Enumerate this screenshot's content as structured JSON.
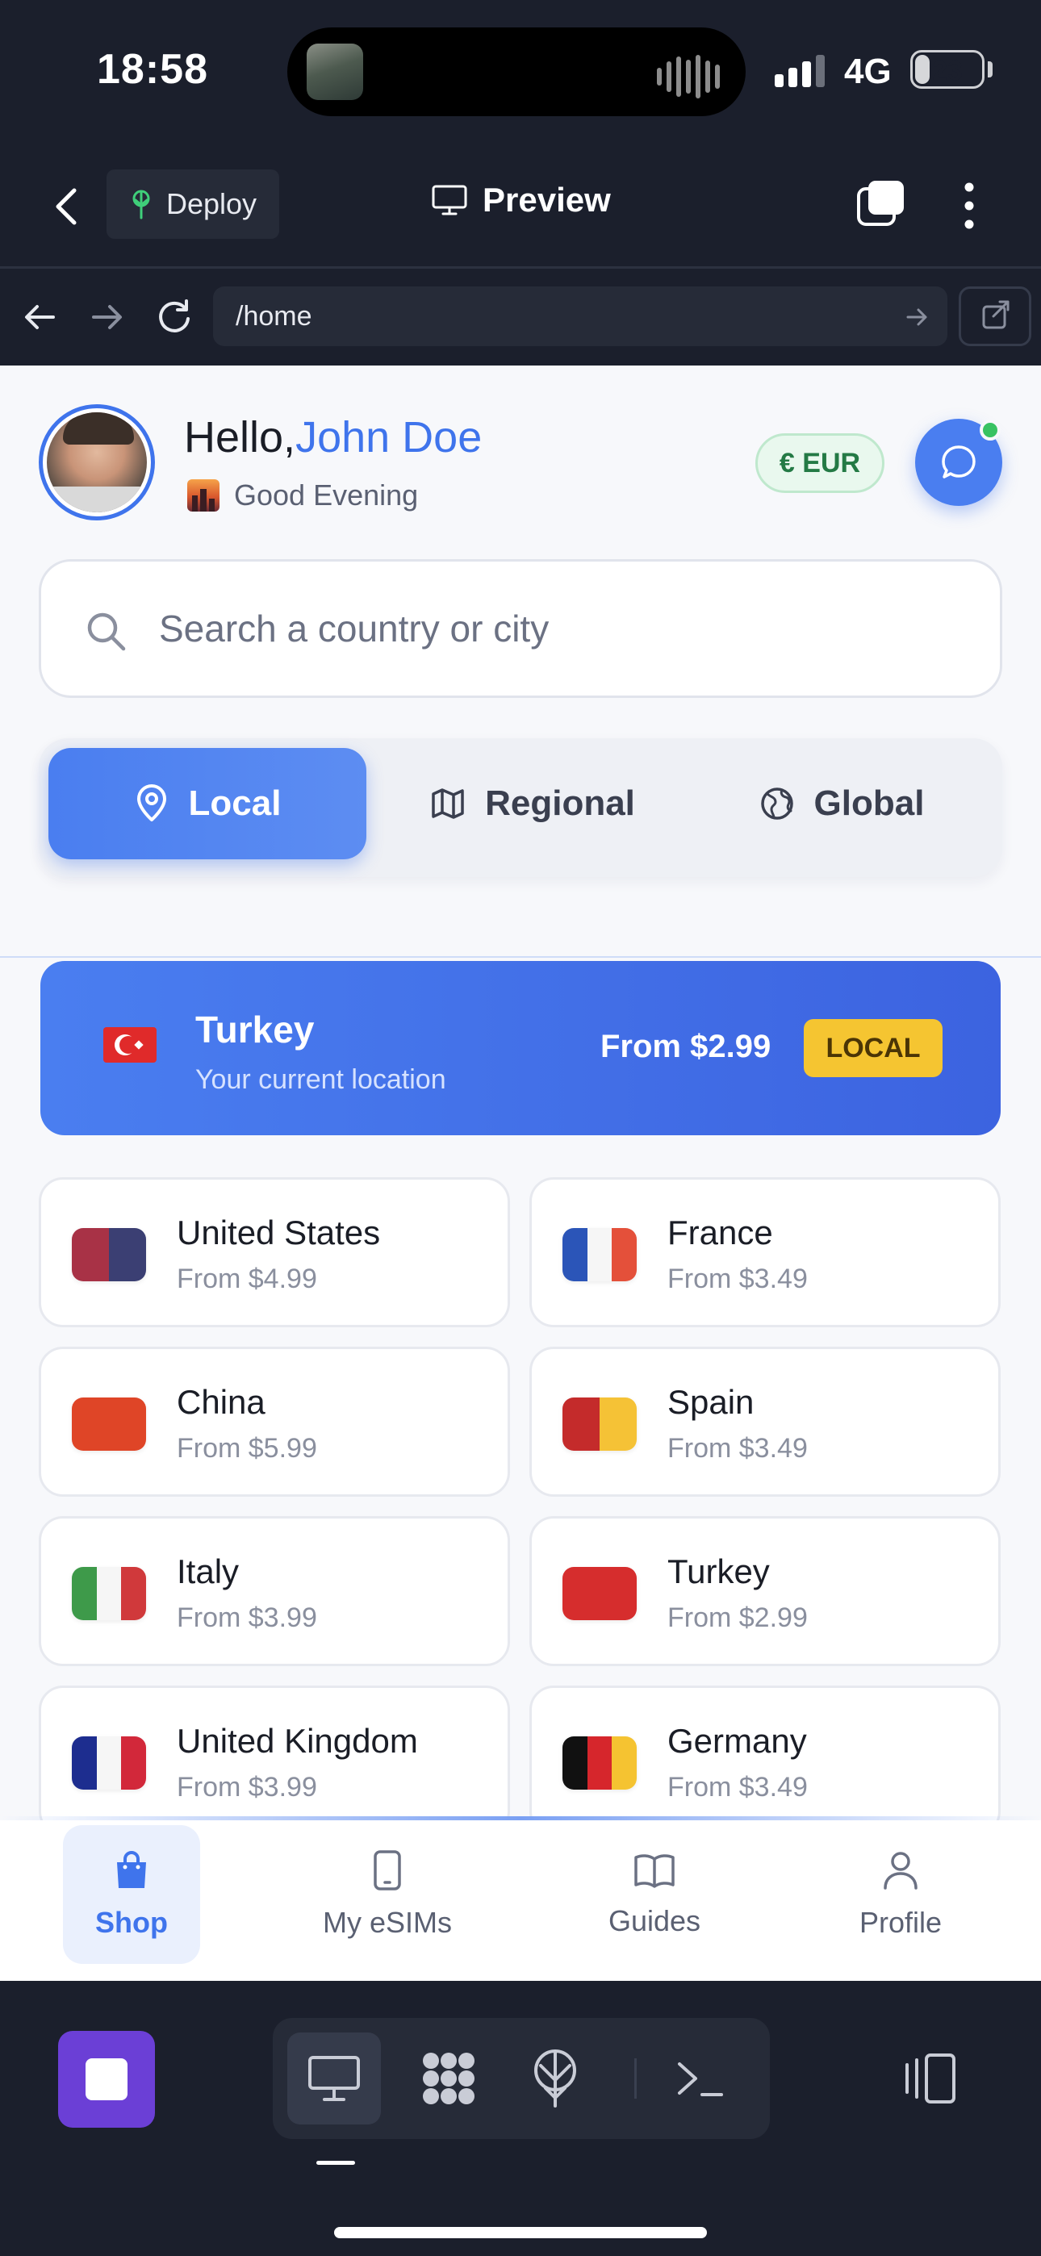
{
  "status_bar": {
    "time": "18:58",
    "network": "4G",
    "battery": "23",
    "battery_level": 0.23
  },
  "ide": {
    "deploy_label": "Deploy",
    "preview_label": "Preview",
    "url": "/home"
  },
  "app": {
    "greeting_prefix": "Hello,",
    "user_name": "John Doe",
    "time_greeting": "Good Evening",
    "currency": "€ EUR",
    "search_placeholder": "Search a country or city",
    "segments": [
      {
        "label": "Local",
        "icon": "map-pin-icon",
        "active": true
      },
      {
        "label": "Regional",
        "icon": "map-icon",
        "active": false
      },
      {
        "label": "Global",
        "icon": "globe-icon",
        "active": false
      }
    ],
    "current_location": {
      "country": "Turkey",
      "subtitle": "Your current location",
      "price": "From $2.99",
      "badge": "LOCAL"
    },
    "countries": [
      {
        "name": "United States",
        "price": "From $4.99",
        "flag_colors": [
          "#a83246",
          "#3b3f73"
        ]
      },
      {
        "name": "France",
        "price": "From $3.49",
        "flag_colors": [
          "#2b55b8",
          "#f6f6f6",
          "#e4503a"
        ]
      },
      {
        "name": "China",
        "price": "From $5.99",
        "flag_colors": [
          "#df4527"
        ]
      },
      {
        "name": "Spain",
        "price": "From $3.49",
        "flag_colors": [
          "#c42b2b",
          "#f5c236"
        ]
      },
      {
        "name": "Italy",
        "price": "From $3.99",
        "flag_colors": [
          "#3e9a4a",
          "#f6f6f6",
          "#d0393b"
        ]
      },
      {
        "name": "Turkey",
        "price": "From $2.99",
        "flag_colors": [
          "#d62d2d"
        ]
      },
      {
        "name": "United Kingdom",
        "price": "From $3.99",
        "flag_colors": [
          "#1d2d8f",
          "#f6f6f6",
          "#d2283a"
        ]
      },
      {
        "name": "Germany",
        "price": "From $3.49",
        "flag_colors": [
          "#111111",
          "#d6262c",
          "#f5c331"
        ]
      }
    ],
    "tabs": [
      {
        "label": "Shop",
        "icon": "shopping-bag-icon",
        "active": true
      },
      {
        "label": "My eSIMs",
        "icon": "phone-icon",
        "active": false
      },
      {
        "label": "Guides",
        "icon": "book-icon",
        "active": false
      },
      {
        "label": "Profile",
        "icon": "user-icon",
        "active": false
      }
    ]
  },
  "colors": {
    "accent": "#3f74ec",
    "ide_background": "#1b1f2c",
    "badge_yellow": "#f5c531",
    "currency_green": "#247a45"
  }
}
